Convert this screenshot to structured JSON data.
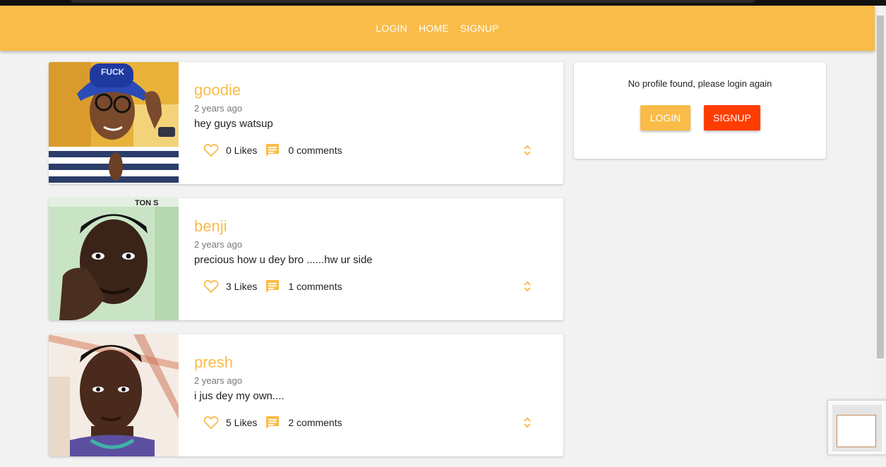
{
  "nav": {
    "links": [
      "LOGIN",
      "HOME",
      "SIGNUP"
    ]
  },
  "posts": [
    {
      "name": "goodie",
      "time": "2 years ago",
      "text": "hey guys watsup",
      "likes": "0 Likes",
      "comments": "0 comments"
    },
    {
      "name": "benji",
      "time": "2 years ago",
      "text": "precious how u dey bro ......hw ur side",
      "likes": "3 Likes",
      "comments": "1 comments"
    },
    {
      "name": "presh",
      "time": "2 years ago",
      "text": "i jus dey my own....",
      "likes": "5 Likes",
      "comments": "2 comments"
    }
  ],
  "profile": {
    "message": "No profile found, please login again",
    "login_label": "LOGIN",
    "signup_label": "SIGNUP"
  },
  "colors": {
    "accent": "#f9bc48",
    "signup": "#ff3d00"
  },
  "icons": {
    "like": "heart-icon",
    "comment": "comment-icon",
    "expand": "expand-icon"
  }
}
